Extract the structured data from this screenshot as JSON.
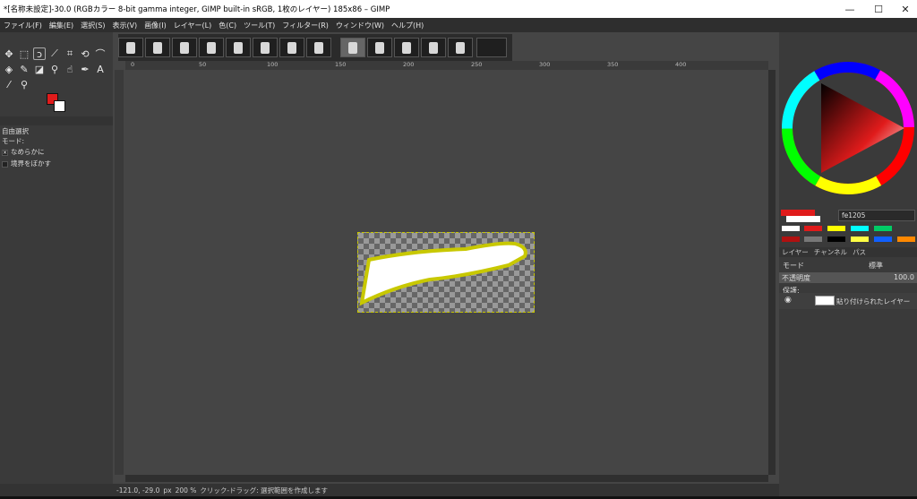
{
  "window": {
    "title": "*[名称未設定]-30.0 (RGBカラー 8-bit gamma integer, GIMP built-in sRGB, 1枚のレイヤー) 185x86 – GIMP",
    "minimize": "—",
    "maximize": "☐",
    "close": "✕"
  },
  "menu": [
    "ファイル(F)",
    "編集(E)",
    "選択(S)",
    "表示(V)",
    "画像(I)",
    "レイヤー(L)",
    "色(C)",
    "ツール(T)",
    "フィルター(R)",
    "ウィンドウ(W)",
    "ヘルプ(H)"
  ],
  "tool_options": {
    "title": "自由選択",
    "mode_label": "モード:",
    "antialias_label": "なめらかに",
    "feather_label": "境界をぼかす"
  },
  "ruler_marks": [
    "0",
    "50",
    "100",
    "150",
    "200",
    "250",
    "300",
    "350",
    "400"
  ],
  "status": {
    "coords": "-121.0, -29.0",
    "unit": "px",
    "zoom": "200 %",
    "message": "クリック-ドラッグ: 選択範囲を作成します"
  },
  "colors": {
    "foreground": "#e01b1b",
    "background": "#ffffff",
    "hex_value": "fe1205"
  },
  "layers_panel": {
    "tabs": [
      "レイヤー",
      "チャンネル",
      "パス"
    ],
    "mode_label": "モード",
    "mode_value": "標準",
    "opacity_label": "不透明度",
    "opacity_value": "100.0",
    "lock_label": "保護:",
    "layer_name": "貼り付けられたレイヤー"
  }
}
